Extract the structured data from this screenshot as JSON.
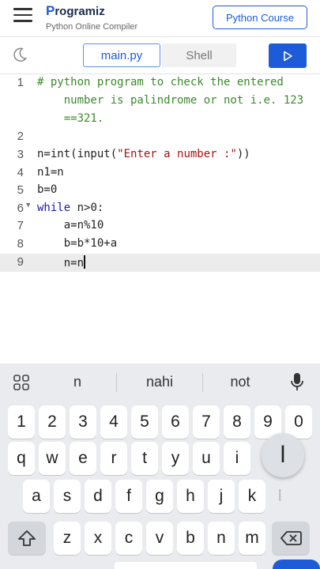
{
  "header": {
    "logo_prefix": "P",
    "logo_text": "rogramiz",
    "logo_subtitle": "Python Online Compiler",
    "course_button": "Python Course"
  },
  "toolbar": {
    "tab_main": "main.py",
    "tab_shell": "Shell"
  },
  "editor": {
    "line_numbers": [
      "1",
      "",
      "",
      "2",
      "3",
      "4",
      "5",
      "6",
      "7",
      "8",
      "9"
    ],
    "active_line": "9"
  },
  "code": {
    "l1a": "# python program to check the entered",
    "l1b": "    number is palindrome or not i.e. 123",
    "l1c": "    ==321.",
    "l3_fn": "n=int(input(",
    "l3_str": "\"Enter a number :\"",
    "l3_end": "))",
    "l4": "n1=n",
    "l5": "b=0",
    "l6_kw": "while",
    "l6_rest": " n>0:",
    "l7": "    a=n%10",
    "l8": "    b=b*10+a",
    "l9": "    n=n"
  },
  "keyboard": {
    "suggestions": [
      "n",
      "nahi",
      "not"
    ],
    "row_numbers": [
      "1",
      "2",
      "3",
      "4",
      "5",
      "6",
      "7",
      "8",
      "9",
      "0"
    ],
    "row_qwerty": [
      "q",
      "w",
      "e",
      "r",
      "t",
      "y",
      "u",
      "i"
    ],
    "row_asdf": [
      "a",
      "s",
      "d",
      "f",
      "g",
      "h",
      "j",
      "k"
    ],
    "row_zxcv": [
      "z",
      "x",
      "c",
      "v",
      "b",
      "n",
      "m"
    ],
    "popup_char": "l",
    "faded_char": "l"
  },
  "colors": {
    "accent": "#1d5bd8",
    "comment": "#3a8a2c",
    "keyword": "#1a1aa6",
    "string": "#a31515",
    "keyboard_bg": "#e9ebee"
  },
  "icons": [
    "hamburger-icon",
    "moon-icon",
    "run-icon",
    "grid-icon",
    "mic-icon",
    "shift-icon",
    "backspace-icon",
    "chevron-down-icon"
  ]
}
